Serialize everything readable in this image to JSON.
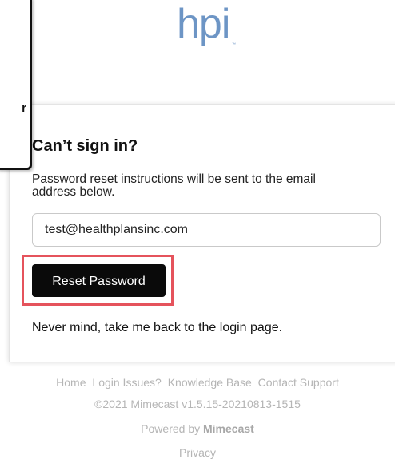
{
  "callout": {
    "visible_text": "r"
  },
  "logo": {
    "text": "hpi",
    "trademark": "™",
    "color": "#6d95c5"
  },
  "card": {
    "title": "Can’t sign in?",
    "description": "Password reset instructions will be sent to the email address below.",
    "email_value": "test@healthplansinc.com",
    "reset_button_label": "Reset Password",
    "back_link": "Never mind, take me back to the login page.",
    "highlight_color": "#e5535c"
  },
  "footer": {
    "links": [
      "Home",
      "Login Issues?",
      "Knowledge Base",
      "Contact Support"
    ],
    "copyright": "©2021 Mimecast v1.5.15-20210813-1515",
    "powered_prefix": "Powered by ",
    "powered_brand": "Mimecast",
    "privacy": "Privacy"
  }
}
